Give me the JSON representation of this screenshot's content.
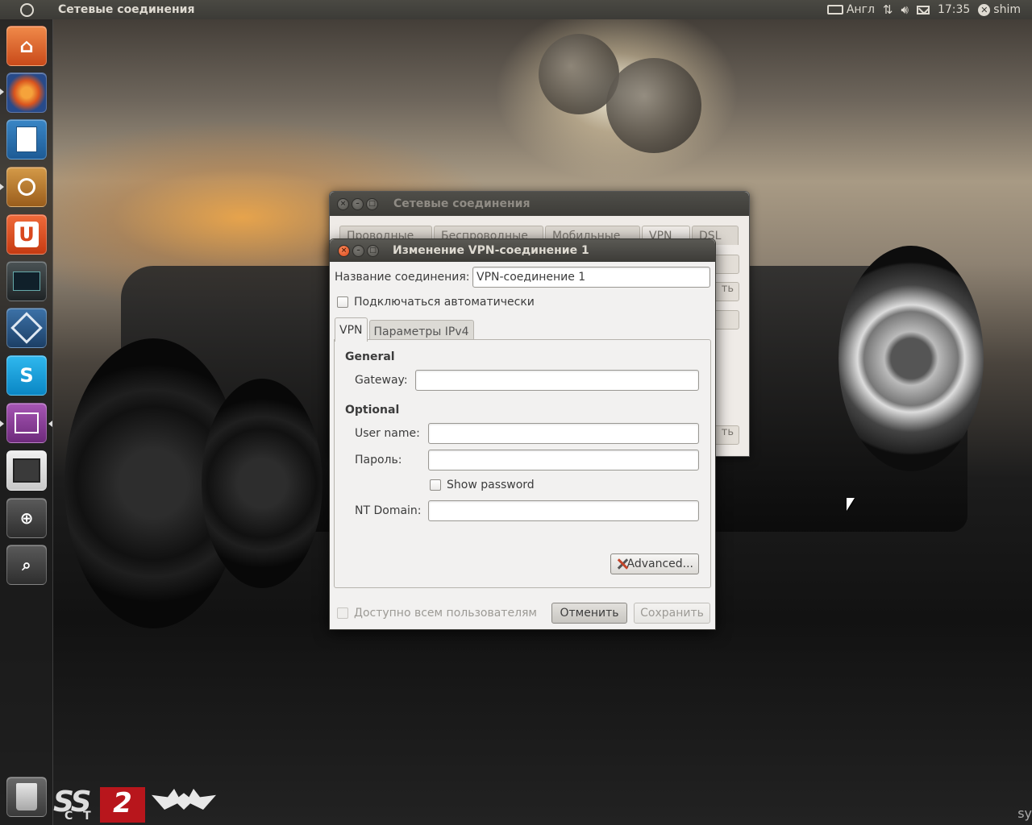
{
  "top_panel": {
    "app_title": "Сетевые соединения",
    "keyboard_layout": "Англ",
    "clock": "17:35",
    "user": "shim"
  },
  "launcher": {
    "items": [
      {
        "name": "home-folder-launcher",
        "icon": "folder-home-icon",
        "color": "#e0602a"
      },
      {
        "name": "firefox-launcher",
        "icon": "firefox-icon",
        "color": "#2a4f8a"
      },
      {
        "name": "libreoffice-writer-launcher",
        "icon": "writer-document-icon",
        "color": "#2c6fa8"
      },
      {
        "name": "software-center-launcher",
        "icon": "software-center-icon",
        "color": "#b5762b"
      },
      {
        "name": "ubuntu-one-launcher",
        "icon": "ubuntu-one-icon",
        "color": "#d9481e"
      },
      {
        "name": "system-monitor-launcher",
        "icon": "system-monitor-icon",
        "color": "#2e3436"
      },
      {
        "name": "virtualbox-launcher",
        "icon": "virtualbox-icon",
        "color": "#2f5d8a"
      },
      {
        "name": "skype-launcher",
        "icon": "skype-icon",
        "color": "#12a5e0"
      },
      {
        "name": "network-connections-launcher",
        "icon": "network-connections-icon",
        "color": "#8b3f98"
      },
      {
        "name": "workspace-switcher-launcher",
        "icon": "workspace-switcher-icon",
        "color": "#4a4a4a"
      },
      {
        "name": "zoom-in-launcher",
        "icon": "zoom-in-icon",
        "color": "#3a3a3a"
      },
      {
        "name": "dash-search-launcher",
        "icon": "dash-search-icon",
        "color": "#3a3a3a"
      }
    ],
    "trash_icon": "trash-icon"
  },
  "bg_window": {
    "title": "Сетевые соединения",
    "tabs": [
      "Проводные",
      "Беспроводные",
      "Мобильные",
      "VPN",
      "DSL"
    ],
    "side_button_labels": [
      "",
      "ть",
      "",
      "ть"
    ]
  },
  "dialog": {
    "title": "Изменение VPN-соединение 1",
    "connection_name_label": "Название соединения:",
    "connection_name_value": "VPN-соединение 1",
    "autoconnect_label": "Подключаться автоматически",
    "tabs": [
      "VPN",
      "Параметры IPv4"
    ],
    "general_header": "General",
    "gateway_label": "Gateway:",
    "gateway_value": "",
    "optional_header": "Optional",
    "username_label": "User name:",
    "username_value": "",
    "password_label": "Пароль:",
    "password_value": "",
    "show_password_label": "Show password",
    "nt_domain_label": "NT Domain:",
    "nt_domain_value": "",
    "advanced_label": "Advanced...",
    "all_users_label": "Доступно всем пользователям",
    "cancel_label": "Отменить",
    "save_label": "Сохранить"
  },
  "wallpaper": {
    "logo_text_left": "SS",
    "logo_text_red": "2",
    "logo_subtext": "C T",
    "corner_text": "sy"
  }
}
